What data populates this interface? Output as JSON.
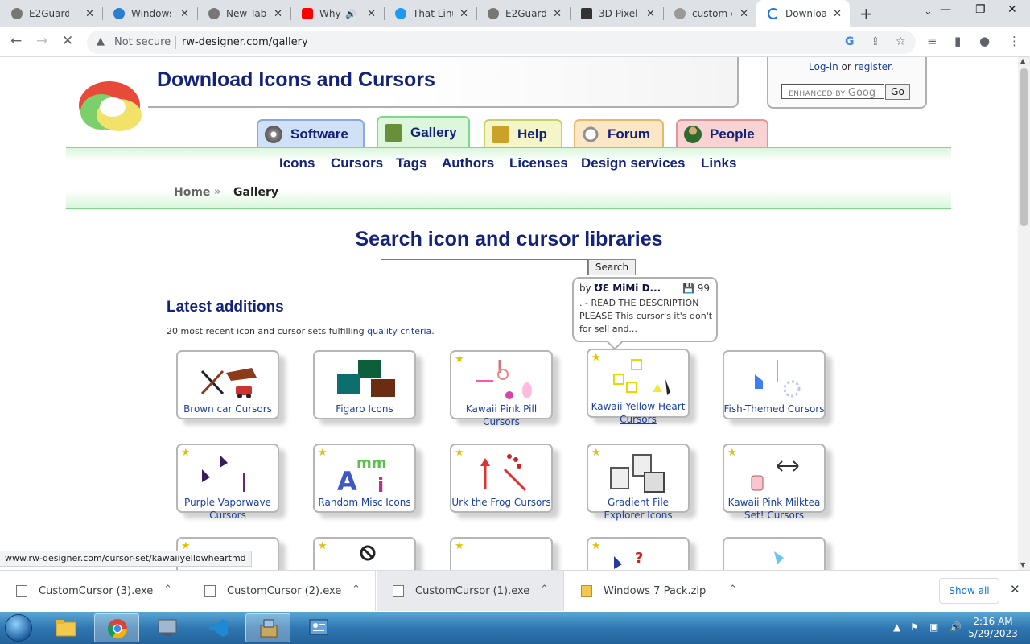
{
  "browser": {
    "tabs": [
      {
        "title": "E2Guardi",
        "color": "#777777"
      },
      {
        "title": "Windows",
        "color": "#2b7cd3"
      },
      {
        "title": "New Tab",
        "color": "#777777"
      },
      {
        "title": "Why",
        "color": "#ff0000"
      },
      {
        "title": "That Linu",
        "color": "#1d9bf0"
      },
      {
        "title": "E2Guardi",
        "color": "#777777"
      },
      {
        "title": "3D Pixel",
        "color": "#333333"
      },
      {
        "title": "custom-c",
        "color": "#999999"
      },
      {
        "title": "Downloa",
        "color": "#1a73e8"
      }
    ],
    "url": "rw-designer.com/gallery",
    "not_secure": "Not secure"
  },
  "site": {
    "title": "Download Icons and Cursors",
    "login": "Log-in",
    "or": "or",
    "register": "register.",
    "search_brand_prefix": "ENHANCED BY",
    "search_brand": "Goog",
    "go": "Go",
    "tabs": {
      "software": "Software",
      "gallery": "Gallery",
      "help": "Help",
      "forum": "Forum",
      "people": "People"
    },
    "subnav": [
      "Icons",
      "Cursors",
      "Tags",
      "Authors",
      "Licenses",
      "Design services",
      "Links"
    ],
    "breadcrumb": {
      "home": "Home",
      "current": "Gallery"
    }
  },
  "main": {
    "heading": "Search icon and cursor libraries",
    "search_button": "Search",
    "latest_title": "Latest additions",
    "latest_desc": "20 most recent icon and cursor sets fulfilling",
    "latest_link": "quality criteria",
    "latest_end": "."
  },
  "tooltip": {
    "by": "by",
    "author": "ƱƐ MiMi D...",
    "count": "99",
    "description": ". - READ THE DESCRIPTION PLEASE This cursor's it's don't for sell and..."
  },
  "gallery": [
    {
      "label": "Brown car Cursors",
      "star": false
    },
    {
      "label": "Figaro Icons",
      "star": false
    },
    {
      "label": "Kawaii Pink Pill Cursors",
      "star": true
    },
    {
      "label": "Kawaii Yellow Heart Cursors",
      "star": true
    },
    {
      "label": "Fish-Themed Cursors",
      "star": false
    },
    {
      "label": "Purple Vaporwave Cursors",
      "star": true
    },
    {
      "label": "Random Misc Icons",
      "star": true
    },
    {
      "label": "Urk the Frog Cursors",
      "star": true
    },
    {
      "label": "Gradient File Explorer Icons",
      "star": true
    },
    {
      "label": "Kawaii Pink Milktea Set! Cursors",
      "star": true
    }
  ],
  "status_url": "www.rw-designer.com/cursor-set/kawaiiyellowheartmd",
  "downloads": [
    {
      "name": "CustomCursor (3).exe"
    },
    {
      "name": "CustomCursor (2).exe"
    },
    {
      "name": "CustomCursor (1).exe"
    },
    {
      "name": "Windows 7 Pack.zip"
    }
  ],
  "downloads_show_all": "Show all",
  "clock": {
    "time": "2:16 AM",
    "date": "5/29/2023"
  }
}
